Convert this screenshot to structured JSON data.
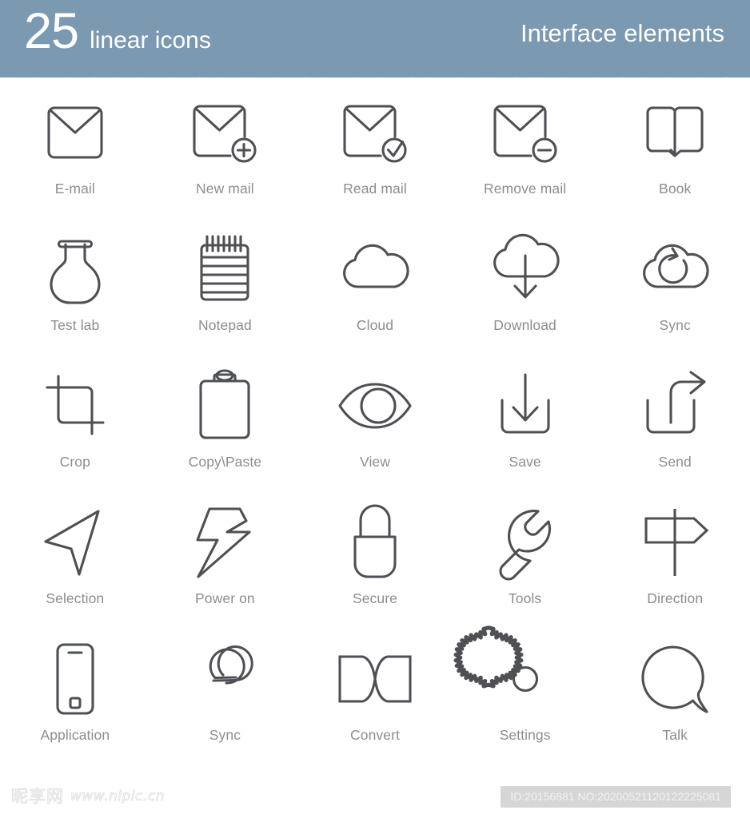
{
  "header": {
    "count": "25",
    "count_caption": "linear icons",
    "title_right": "Interface elements",
    "background_color": "#7b99b1",
    "text_color": "#ffffff"
  },
  "theme": {
    "icon_stroke_color": "#4e5054",
    "label_color": "#8b8d90",
    "page_background": "#ffffff"
  },
  "icons": [
    {
      "label": "E-mail",
      "icon_name": "envelope-icon"
    },
    {
      "label": "New mail",
      "icon_name": "envelope-plus-icon"
    },
    {
      "label": "Read mail",
      "icon_name": "envelope-check-icon"
    },
    {
      "label": "Remove mail",
      "icon_name": "envelope-minus-icon"
    },
    {
      "label": "Book",
      "icon_name": "open-book-icon"
    },
    {
      "label": "Test lab",
      "icon_name": "flask-icon"
    },
    {
      "label": "Notepad",
      "icon_name": "notepad-icon"
    },
    {
      "label": "Cloud",
      "icon_name": "cloud-icon"
    },
    {
      "label": "Download",
      "icon_name": "cloud-download-icon"
    },
    {
      "label": "Sync",
      "icon_name": "cloud-sync-icon"
    },
    {
      "label": "Crop",
      "icon_name": "crop-icon"
    },
    {
      "label": "Copy\\Paste",
      "icon_name": "clipboard-icon"
    },
    {
      "label": "View",
      "icon_name": "eye-icon"
    },
    {
      "label": "Save",
      "icon_name": "save-download-tray-icon"
    },
    {
      "label": "Send",
      "icon_name": "send-share-icon"
    },
    {
      "label": "Selection",
      "icon_name": "cursor-arrow-icon"
    },
    {
      "label": "Power on",
      "icon_name": "lightning-bolt-icon"
    },
    {
      "label": "Secure",
      "icon_name": "padlock-icon"
    },
    {
      "label": "Tools",
      "icon_name": "wrench-icon"
    },
    {
      "label": "Direction",
      "icon_name": "signpost-icon"
    },
    {
      "label": "Application",
      "icon_name": "smartphone-icon"
    },
    {
      "label": "Sync",
      "icon_name": "infinity-loop-icon"
    },
    {
      "label": "Convert",
      "icon_name": "bowtie-convert-icon"
    },
    {
      "label": "Settings",
      "icon_name": "gear-icon"
    },
    {
      "label": "Talk",
      "icon_name": "speech-bubble-icon"
    }
  ],
  "footer": {
    "watermark_cn": "昵享网",
    "watermark_url": "www.nipic.cn",
    "id_text": "ID:20156881 NO:20200521120122225081"
  }
}
